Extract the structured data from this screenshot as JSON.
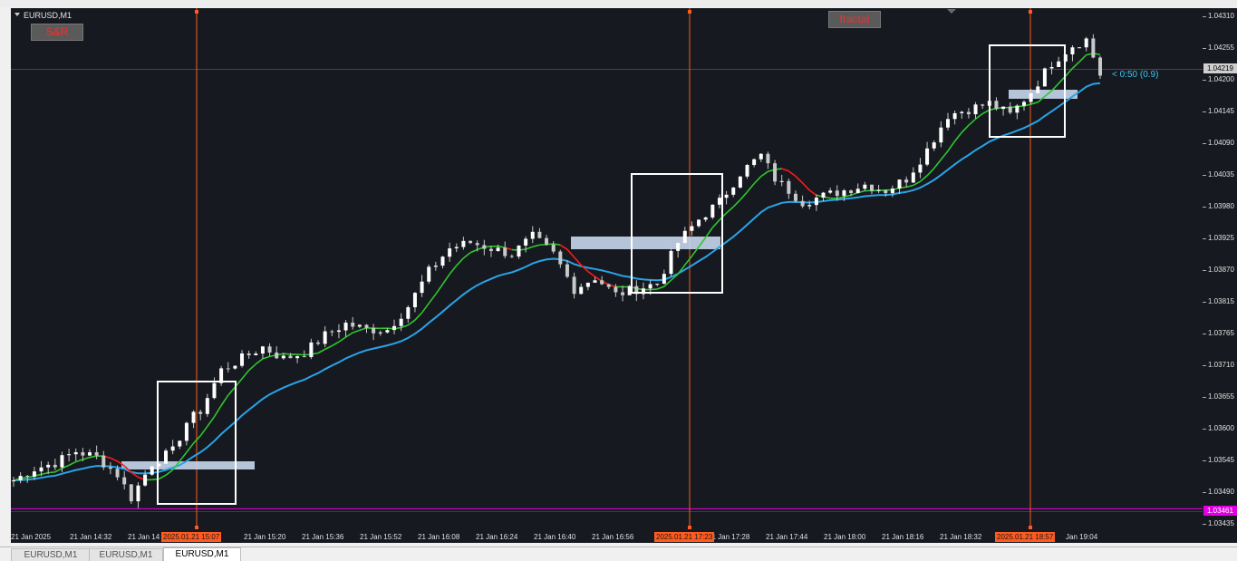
{
  "chart": {
    "symbol_label": "EURUSD,M1",
    "buttons": {
      "sr": "S&R",
      "fractal": "fractal"
    },
    "countdown": "< 0:50 (0.9)",
    "current_price_label": "1.04219",
    "level_price_label": "1.03461",
    "colors": {
      "background": "#16191f",
      "candle": "#c8c8c8",
      "ma_fast": "#2fc62f",
      "ma_slow": "#2aa3e8",
      "ma_fast_down": "#ff1a1a",
      "zone": "#c7d7ec",
      "box": "#ffffff",
      "vline": "#ff5a1f",
      "level": "#e200e2"
    }
  },
  "price_ticks": [
    "1.04310",
    "1.04255",
    "1.04200",
    "1.04145",
    "1.04090",
    "1.04035",
    "1.03980",
    "1.03925",
    "1.03870",
    "1.03815",
    "1.03765",
    "1.03710",
    "1.03655",
    "1.03600",
    "1.03545",
    "1.03490",
    "1.03435"
  ],
  "time_labels": [
    "21 Jan 2025",
    "21 Jan 14:32",
    "21 Jan 14",
    "21 Jan 15:20",
    "21 Jan 15:36",
    "21 Jan 15:52",
    "21 Jan 16:08",
    "21 Jan 16:24",
    "21 Jan 16:40",
    "21 Jan 16:56",
    "21 Jan 17:28",
    "21 Jan 17:44",
    "21 Jan 18:00",
    "21 Jan 18:16",
    "21 Jan 18:32",
    "Jan 19:04"
  ],
  "highlight_times": [
    "2025.01.21 15:07",
    "2025.01.21 17:23",
    "2025.01.21 18:57"
  ],
  "tabs": [
    {
      "label": "EURUSD,M1",
      "active": false
    },
    {
      "label": "EURUSD,M1",
      "active": false
    },
    {
      "label": "EURUSD,M1",
      "active": true
    }
  ],
  "chart_data": {
    "type": "candlestick",
    "symbol": "EURUSD",
    "timeframe": "M1",
    "ylim": [
      1.03435,
      1.0431
    ],
    "close_path": [
      [
        0,
        1.0351
      ],
      [
        3,
        1.0353
      ],
      [
        6,
        1.0354
      ],
      [
        9,
        1.0356
      ],
      [
        12,
        1.0355
      ],
      [
        15,
        1.0352
      ],
      [
        17,
        1.0348
      ],
      [
        20,
        1.0354
      ],
      [
        23,
        1.0356
      ],
      [
        25,
        1.0361
      ],
      [
        27,
        1.0363
      ],
      [
        30,
        1.037
      ],
      [
        33,
        1.0372
      ],
      [
        36,
        1.0374
      ],
      [
        39,
        1.0372
      ],
      [
        42,
        1.0373
      ],
      [
        45,
        1.0376
      ],
      [
        48,
        1.0378
      ],
      [
        51,
        1.0377
      ],
      [
        54,
        1.0377
      ],
      [
        57,
        1.0381
      ],
      [
        60,
        1.0387
      ],
      [
        63,
        1.0391
      ],
      [
        66,
        1.0392
      ],
      [
        69,
        1.0391
      ],
      [
        72,
        1.039
      ],
      [
        75,
        1.0393
      ],
      [
        78,
        1.039
      ],
      [
        81,
        1.0384
      ],
      [
        84,
        1.0386
      ],
      [
        87,
        1.0383
      ],
      [
        90,
        1.0384
      ],
      [
        93,
        1.0385
      ],
      [
        96,
        1.0392
      ],
      [
        99,
        1.0396
      ],
      [
        102,
        1.0399
      ],
      [
        105,
        1.0404
      ],
      [
        108,
        1.0407
      ],
      [
        110,
        1.0403
      ],
      [
        112,
        1.0401
      ],
      [
        114,
        1.0399
      ],
      [
        117,
        1.04
      ],
      [
        120,
        1.0401
      ],
      [
        123,
        1.0402
      ],
      [
        126,
        1.0401
      ],
      [
        129,
        1.0403
      ],
      [
        132,
        1.0408
      ],
      [
        135,
        1.0414
      ],
      [
        138,
        1.0415
      ],
      [
        141,
        1.0416
      ],
      [
        144,
        1.0414
      ],
      [
        147,
        1.0418
      ],
      [
        150,
        1.0423
      ],
      [
        153,
        1.0426
      ],
      [
        155,
        1.0427
      ],
      [
        157,
        1.0421
      ]
    ]
  }
}
